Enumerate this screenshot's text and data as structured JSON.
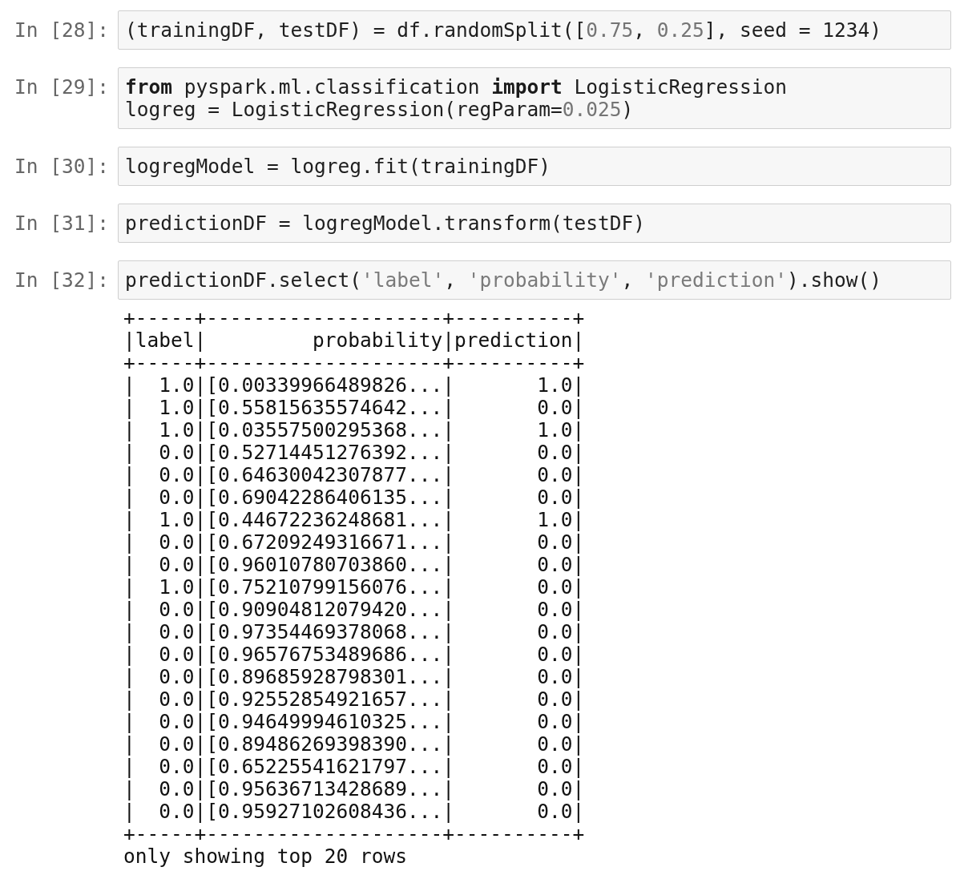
{
  "cells": [
    {
      "prompt": "In [28]:",
      "lines": [
        [
          {
            "kind": "plain",
            "text": "(trainingDF, testDF) = df.randomSplit(["
          },
          {
            "kind": "number",
            "text": "0.75"
          },
          {
            "kind": "plain",
            "text": ", "
          },
          {
            "kind": "number",
            "text": "0.25"
          },
          {
            "kind": "plain",
            "text": "], seed = 1234)"
          }
        ]
      ]
    },
    {
      "prompt": "In [29]:",
      "lines": [
        [
          {
            "kind": "keyword",
            "text": "from"
          },
          {
            "kind": "plain",
            "text": " pyspark.ml.classification "
          },
          {
            "kind": "keyword",
            "text": "import"
          },
          {
            "kind": "plain",
            "text": " LogisticRegression"
          }
        ],
        [
          {
            "kind": "plain",
            "text": "logreg = LogisticRegression(regParam="
          },
          {
            "kind": "number",
            "text": "0.025"
          },
          {
            "kind": "plain",
            "text": ")"
          }
        ]
      ]
    },
    {
      "prompt": "In [30]:",
      "lines": [
        [
          {
            "kind": "plain",
            "text": "logregModel = logreg.fit(trainingDF)"
          }
        ]
      ]
    },
    {
      "prompt": "In [31]:",
      "lines": [
        [
          {
            "kind": "plain",
            "text": "predictionDF = logregModel.transform(testDF)"
          }
        ]
      ]
    },
    {
      "prompt": "In [32]:",
      "lines": [
        [
          {
            "kind": "plain",
            "text": "predictionDF.select("
          },
          {
            "kind": "string",
            "text": "'label'"
          },
          {
            "kind": "plain",
            "text": ", "
          },
          {
            "kind": "string",
            "text": "'probability'"
          },
          {
            "kind": "plain",
            "text": ", "
          },
          {
            "kind": "string",
            "text": "'prediction'"
          },
          {
            "kind": "plain",
            "text": ").show()"
          }
        ]
      ],
      "output": {
        "top_border": "+-----+--------------------+----------+",
        "header": "|label|         probability|prediction|",
        "header_border": "+-----+--------------------+----------+",
        "rows": [
          "|  1.0|[0.00339966489826...|       1.0|",
          "|  1.0|[0.55815635574642...|       0.0|",
          "|  1.0|[0.03557500295368...|       1.0|",
          "|  0.0|[0.52714451276392...|       0.0|",
          "|  0.0|[0.64630042307877...|       0.0|",
          "|  0.0|[0.69042286406135...|       0.0|",
          "|  1.0|[0.44672236248681...|       1.0|",
          "|  0.0|[0.67209249316671...|       0.0|",
          "|  0.0|[0.96010780703860...|       0.0|",
          "|  1.0|[0.75210799156076...|       0.0|",
          "|  0.0|[0.90904812079420...|       0.0|",
          "|  0.0|[0.97354469378068...|       0.0|",
          "|  0.0|[0.96576753489686...|       0.0|",
          "|  0.0|[0.89685928798301...|       0.0|",
          "|  0.0|[0.92552854921657...|       0.0|",
          "|  0.0|[0.94649994610325...|       0.0|",
          "|  0.0|[0.89486269398390...|       0.0|",
          "|  0.0|[0.65225541621797...|       0.0|",
          "|  0.0|[0.95636713428689...|       0.0|",
          "|  0.0|[0.95927102608436...|       0.0|"
        ],
        "bottom_border": "+-----+--------------------+----------+",
        "note": "only showing top 20 rows"
      }
    }
  ]
}
